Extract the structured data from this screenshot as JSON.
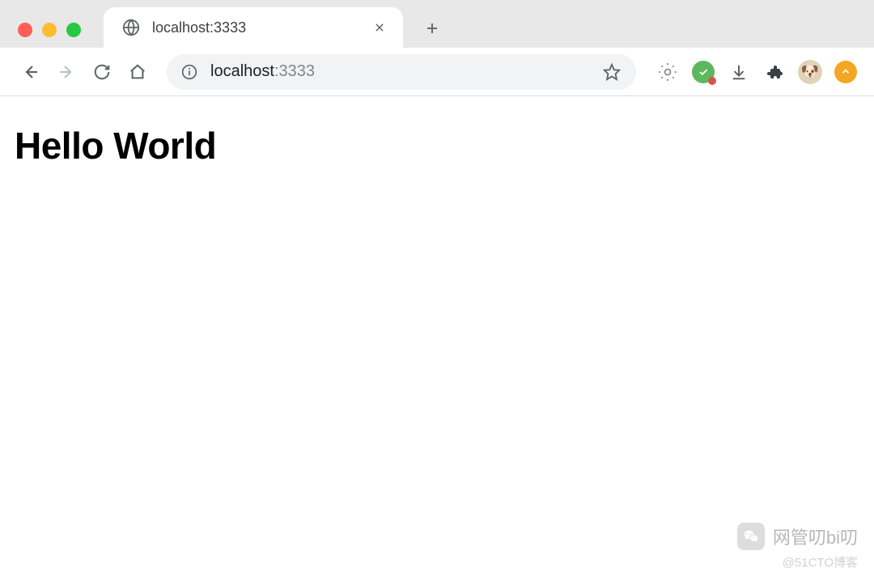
{
  "window": {
    "tab_title": "localhost:3333"
  },
  "omnibox": {
    "host": "localhost",
    "path": ":3333"
  },
  "page": {
    "heading": "Hello World"
  },
  "watermark": {
    "main": "网管叨bi叨",
    "sub": "@51CTO博客"
  }
}
